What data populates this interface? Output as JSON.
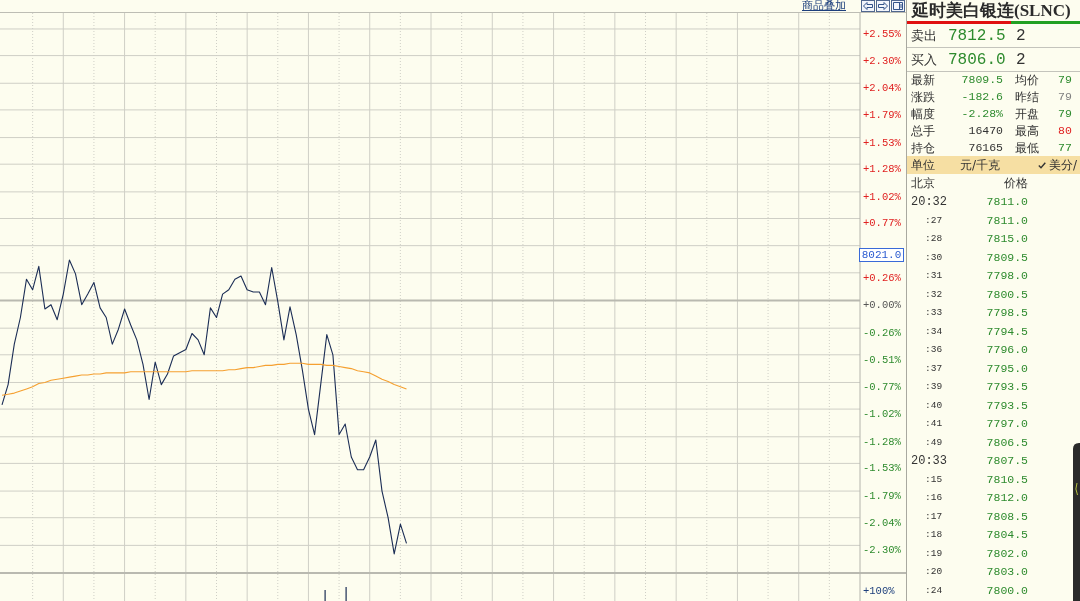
{
  "chart": {
    "overlay_link": "商品叠加",
    "chart_data": [
      {
        "type": "line",
        "ylim": [
          -2.55,
          2.7
        ],
        "grid": true,
        "yticks": [
          {
            "value": 2.55,
            "label": "+2.55%"
          },
          {
            "value": 2.3,
            "label": "+2.30%"
          },
          {
            "value": 2.04,
            "label": "+2.04%"
          },
          {
            "value": 1.79,
            "label": "+1.79%"
          },
          {
            "value": 1.53,
            "label": "+1.53%"
          },
          {
            "value": 1.28,
            "label": "+1.28%"
          },
          {
            "value": 1.02,
            "label": "+1.02%"
          },
          {
            "value": 0.77,
            "label": "+0.77%"
          },
          {
            "value": 0.26,
            "label": "+0.26%"
          },
          {
            "value": 0,
            "label": "+0.00%"
          },
          {
            "value": -0.26,
            "label": "-0.26%"
          },
          {
            "value": -0.51,
            "label": "-0.51%"
          },
          {
            "value": -0.77,
            "label": "-0.77%"
          },
          {
            "value": -1.02,
            "label": "-1.02%"
          },
          {
            "value": -1.28,
            "label": "-1.28%"
          },
          {
            "value": -1.53,
            "label": "-1.53%"
          },
          {
            "value": -1.79,
            "label": "-1.79%"
          },
          {
            "value": -2.04,
            "label": "-2.04%"
          },
          {
            "value": -2.3,
            "label": "-2.30%"
          }
        ],
        "series": [
          {
            "color": "#1b2d55",
            "values": [
              -0.98,
              -0.79,
              -0.41,
              -0.16,
              0.2,
              0.1,
              0.32,
              -0.08,
              -0.04,
              -0.18,
              0.06,
              0.38,
              0.25,
              -0.04,
              0.06,
              0.17,
              -0.07,
              -0.16,
              -0.41,
              -0.27,
              -0.08,
              -0.23,
              -0.37,
              -0.6,
              -0.93,
              -0.58,
              -0.79,
              -0.69,
              -0.52,
              -0.49,
              -0.46,
              -0.31,
              -0.37,
              -0.51,
              -0.07,
              -0.16,
              0.06,
              0.1,
              0.2,
              0.23,
              0.1,
              0.08,
              0.08,
              -0.04,
              0.31,
              -0.01,
              -0.37,
              -0.06,
              -0.32,
              -0.65,
              -1.02,
              -1.26,
              -0.79,
              -0.32,
              -0.51,
              -1.26,
              -1.16,
              -1.47,
              -1.59,
              -1.59,
              -1.47,
              -1.31,
              -1.79,
              -2.04,
              -2.38,
              -2.1,
              -2.28,
              null,
              null,
              null,
              null,
              null,
              null,
              null,
              null,
              null,
              null,
              null,
              null,
              null,
              null,
              null,
              null,
              null,
              null,
              null,
              null,
              null,
              null,
              null,
              null,
              null,
              null,
              null,
              null,
              null,
              null,
              null,
              null,
              null,
              null,
              null,
              null,
              null,
              null,
              null,
              null,
              null,
              null,
              null,
              null,
              null,
              null,
              null,
              null,
              null,
              null,
              null,
              null,
              null,
              null,
              null,
              null,
              null,
              null,
              null,
              null,
              null,
              null,
              null,
              null,
              null,
              null,
              null,
              null,
              null,
              null,
              null,
              null,
              null
            ]
          },
          {
            "color": "#f5a030",
            "values": [
              -0.89,
              -0.88,
              -0.87,
              -0.85,
              -0.83,
              -0.81,
              -0.78,
              -0.77,
              -0.75,
              -0.74,
              -0.73,
              -0.72,
              -0.71,
              -0.7,
              -0.7,
              -0.69,
              -0.69,
              -0.68,
              -0.68,
              -0.68,
              -0.68,
              -0.67,
              -0.67,
              -0.67,
              -0.67,
              -0.67,
              -0.67,
              -0.67,
              -0.67,
              -0.67,
              -0.67,
              -0.66,
              -0.66,
              -0.66,
              -0.66,
              -0.66,
              -0.66,
              -0.65,
              -0.65,
              -0.64,
              -0.63,
              -0.63,
              -0.62,
              -0.61,
              -0.61,
              -0.6,
              -0.6,
              -0.59,
              -0.59,
              -0.59,
              -0.6,
              -0.6,
              -0.6,
              -0.61,
              -0.61,
              -0.62,
              -0.63,
              -0.64,
              -0.66,
              -0.67,
              -0.68,
              -0.71,
              -0.74,
              -0.76,
              -0.79,
              -0.81,
              -0.83,
              null,
              null,
              null,
              null,
              null,
              null,
              null,
              null,
              null,
              null,
              null,
              null,
              null,
              null,
              null,
              null,
              null,
              null,
              null,
              null,
              null,
              null,
              null,
              null,
              null,
              null,
              null,
              null,
              null,
              null,
              null,
              null,
              null,
              null,
              null,
              null,
              null,
              null,
              null,
              null,
              null,
              null,
              null,
              null,
              null,
              null,
              null,
              null,
              null,
              null,
              null,
              null,
              null,
              null,
              null,
              null,
              null,
              null,
              null,
              null,
              null,
              null,
              null,
              null,
              null,
              null,
              null,
              null,
              null,
              null,
              null,
              null,
              null
            ]
          }
        ],
        "annotations": [
          "8021.0"
        ]
      }
    ],
    "volume_pane": {
      "axis_label": "+100%"
    }
  },
  "quote": {
    "title": "延时美白银连(SLNC)",
    "ratio_bar": {
      "level": 0.6
    },
    "orders": [
      {
        "label": "卖出",
        "price": "7812.5",
        "volume": "2"
      },
      {
        "label": "买入",
        "price": "7806.0",
        "volume": "2"
      }
    ],
    "stats": [
      {
        "label": "最新",
        "value": "7809.5",
        "color": "#2e8b2e"
      },
      {
        "label": "均价",
        "value": "79",
        "color": "#2e8b2e"
      },
      {
        "label": "涨跌",
        "value": "-182.6",
        "color": "#2e8b2e"
      },
      {
        "label": "昨结",
        "value": "79",
        "color": "#808080"
      },
      {
        "label": "幅度",
        "value": "-2.28%",
        "color": "#2e8b2e"
      },
      {
        "label": "开盘",
        "value": "79",
        "color": "#2e8b2e"
      },
      {
        "label": "总手",
        "value": "16470",
        "color": "#333333"
      },
      {
        "label": "最高",
        "value": "80",
        "color": "#e02020"
      },
      {
        "label": "持仓",
        "value": "76165",
        "color": "#333333"
      },
      {
        "label": "最低",
        "value": "77",
        "color": "#2e8b2e"
      }
    ],
    "unit_row": {
      "label": "单位",
      "value": "元/千克",
      "toggle": {
        "label": "美分/",
        "checked": true
      }
    }
  },
  "trades": {
    "columns": [
      "北京",
      "价格"
    ],
    "rows": [
      {
        "time": "20:32",
        "price": "7811.0",
        "kind": "minute"
      },
      {
        "time": ":27",
        "price": "7811.0",
        "kind": "second"
      },
      {
        "time": ":28",
        "price": "7815.0",
        "kind": "second"
      },
      {
        "time": ":30",
        "price": "7809.5",
        "kind": "second"
      },
      {
        "time": ":31",
        "price": "7798.0",
        "kind": "second"
      },
      {
        "time": ":32",
        "price": "7800.5",
        "kind": "second"
      },
      {
        "time": ":33",
        "price": "7798.5",
        "kind": "second"
      },
      {
        "time": ":34",
        "price": "7794.5",
        "kind": "second"
      },
      {
        "time": ":36",
        "price": "7796.0",
        "kind": "second"
      },
      {
        "time": ":37",
        "price": "7795.0",
        "kind": "second"
      },
      {
        "time": ":39",
        "price": "7793.5",
        "kind": "second"
      },
      {
        "time": ":40",
        "price": "7793.5",
        "kind": "second"
      },
      {
        "time": ":41",
        "price": "7797.0",
        "kind": "second"
      },
      {
        "time": ":49",
        "price": "7806.5",
        "kind": "second"
      },
      {
        "time": "20:33",
        "price": "7807.5",
        "kind": "minute"
      },
      {
        "time": ":15",
        "price": "7810.5",
        "kind": "second"
      },
      {
        "time": ":16",
        "price": "7812.0",
        "kind": "second"
      },
      {
        "time": ":17",
        "price": "7808.5",
        "kind": "second"
      },
      {
        "time": ":18",
        "price": "7804.5",
        "kind": "second"
      },
      {
        "time": ":19",
        "price": "7802.0",
        "kind": "second"
      },
      {
        "time": ":20",
        "price": "7803.0",
        "kind": "second"
      },
      {
        "time": ":24",
        "price": "7800.0",
        "kind": "second"
      }
    ]
  }
}
